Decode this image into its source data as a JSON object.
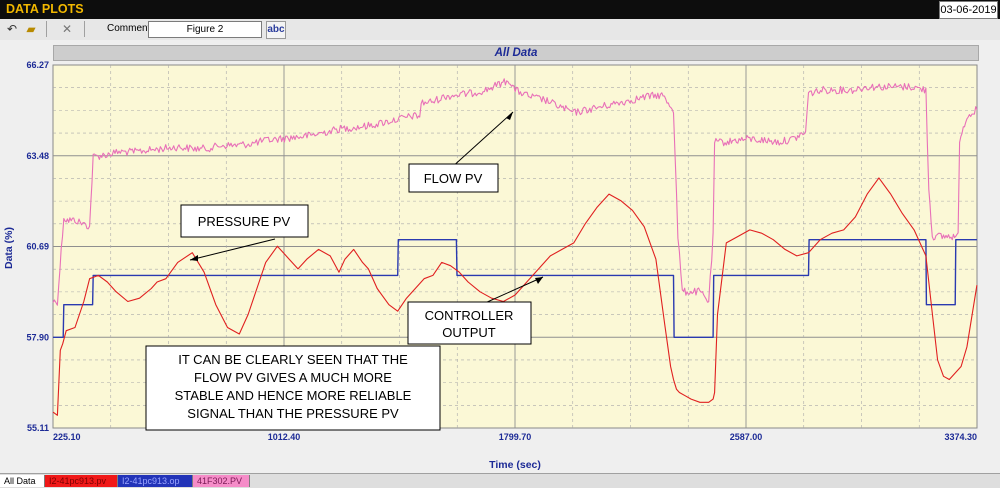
{
  "app": {
    "title": "DATA PLOTS",
    "date": "03-06-2019"
  },
  "toolbar": {
    "comment_label": "Comment",
    "comment_value": "Figure 2",
    "spell_label": "abc"
  },
  "tabs": [
    {
      "label": "All Data",
      "color": "#ffffff"
    },
    {
      "label": "I2-41pc913.pv",
      "color": "#f01818"
    },
    {
      "label": "I2-41pc913.op",
      "color": "#2233b8"
    },
    {
      "label": "41F302.PV",
      "color": "#f58cc8"
    }
  ],
  "annotations": {
    "flow_pv": "FLOW PV",
    "pressure_pv": "PRESSURE PV",
    "controller_output_line1": "CONTROLLER",
    "controller_output_line2": "OUTPUT",
    "note_line1": "IT CAN BE CLEARLY SEEN THAT THE",
    "note_line2": "FLOW PV GIVES A MUCH MORE",
    "note_line3": "STABLE AND HENCE MORE RELIABLE",
    "note_line4": "SIGNAL THAN THE PRESSURE PV"
  },
  "chart_data": {
    "type": "line",
    "title": "All Data",
    "xlabel": "Time (sec)",
    "ylabel": "Data (%)",
    "xlim": [
      225.1,
      3374.3
    ],
    "ylim": [
      55.11,
      66.27
    ],
    "xticks": [
      "225.10",
      "1012.40",
      "1799.70",
      "2587.00",
      "3374.30"
    ],
    "yticks": [
      "55.11",
      "57.90",
      "60.69",
      "63.48",
      "66.27"
    ],
    "grid": true,
    "colors": {
      "flow": "#e870b8",
      "pressure": "#e02020",
      "output": "#2a3ab0",
      "plot_bg": "#fbf8d6"
    },
    "series": [
      {
        "name": "41F302.PV",
        "x": [
          225,
          240,
          262,
          270,
          300,
          350,
          362,
          400,
          450,
          500,
          550,
          600,
          650,
          700,
          750,
          800,
          850,
          900,
          950,
          1000,
          1050,
          1100,
          1150,
          1200,
          1250,
          1300,
          1350,
          1400,
          1450,
          1475,
          1480,
          1520,
          1560,
          1600,
          1650,
          1700,
          1750,
          1780,
          1800,
          1850,
          1900,
          1950,
          2000,
          2050,
          2100,
          2150,
          2200,
          2250,
          2300,
          2340,
          2355,
          2370,
          2390,
          2430,
          2460,
          2475,
          2480,
          2520,
          2550,
          2600,
          2650,
          2700,
          2750,
          2790,
          2800,
          2850,
          2900,
          2950,
          3000,
          3050,
          3100,
          3150,
          3200,
          3210,
          3222,
          3260,
          3290,
          3310,
          3315,
          3340,
          3374
        ],
        "values": [
          59.0,
          59.0,
          61.6,
          61.5,
          61.5,
          61.3,
          63.45,
          63.5,
          63.6,
          63.6,
          63.65,
          63.7,
          63.75,
          63.7,
          63.7,
          63.8,
          63.8,
          63.85,
          63.95,
          64.0,
          64.05,
          64.1,
          64.2,
          64.3,
          64.35,
          64.4,
          64.5,
          64.6,
          64.7,
          64.7,
          65.1,
          65.15,
          65.3,
          65.35,
          65.4,
          65.5,
          65.7,
          65.8,
          65.5,
          65.3,
          65.2,
          65.0,
          64.8,
          64.9,
          65.0,
          65.1,
          65.2,
          65.3,
          65.35,
          64.9,
          61.0,
          59.3,
          59.3,
          59.3,
          59.0,
          61.0,
          63.9,
          63.9,
          63.95,
          64.0,
          63.95,
          63.9,
          64.0,
          64.2,
          65.4,
          65.5,
          65.5,
          65.5,
          65.6,
          65.6,
          65.6,
          65.6,
          65.5,
          62.5,
          61.0,
          61.0,
          61.0,
          61.0,
          64.0,
          64.7,
          64.9
        ]
      },
      {
        "name": "I2-41pc913.pv",
        "x": [
          225,
          240,
          250,
          258,
          270,
          300,
          330,
          350,
          380,
          410,
          440,
          480,
          520,
          560,
          580,
          610,
          650,
          700,
          740,
          780,
          820,
          860,
          890,
          920,
          950,
          990,
          1030,
          1060,
          1090,
          1130,
          1170,
          1200,
          1220,
          1250,
          1280,
          1300,
          1330,
          1370,
          1400,
          1430,
          1460,
          1490,
          1520,
          1550,
          1580,
          1610,
          1640,
          1680,
          1720,
          1760,
          1800,
          1840,
          1880,
          1920,
          1960,
          2000,
          2040,
          2080,
          2120,
          2160,
          2200,
          2240,
          2280,
          2310,
          2330,
          2340,
          2350,
          2360,
          2380,
          2400,
          2430,
          2460,
          2475,
          2480,
          2490,
          2520,
          2560,
          2600,
          2640,
          2680,
          2720,
          2760,
          2800,
          2840,
          2880,
          2920,
          2960,
          3000,
          3040,
          3080,
          3120,
          3160,
          3200,
          3220,
          3240,
          3260,
          3280,
          3300,
          3320,
          3340,
          3374
        ],
        "values": [
          55.6,
          55.5,
          57.5,
          57.7,
          58.1,
          58.2,
          59.0,
          59.7,
          59.8,
          59.6,
          59.3,
          59.0,
          59.1,
          59.4,
          59.6,
          59.7,
          60.2,
          60.5,
          59.9,
          58.9,
          58.2,
          58.0,
          58.6,
          59.4,
          60.2,
          60.7,
          60.3,
          60.0,
          60.3,
          60.6,
          60.4,
          59.9,
          60.3,
          60.6,
          60.2,
          60.0,
          59.4,
          58.9,
          58.7,
          59.1,
          59.4,
          59.7,
          59.8,
          60.2,
          60.1,
          59.9,
          59.6,
          59.3,
          59.1,
          59.0,
          59.2,
          59.6,
          60.0,
          60.4,
          60.6,
          60.8,
          61.4,
          61.9,
          62.3,
          62.1,
          61.8,
          61.3,
          60.3,
          58.3,
          57.0,
          56.6,
          56.3,
          56.2,
          56.1,
          56.0,
          55.9,
          55.9,
          56.0,
          56.2,
          58.6,
          60.8,
          61.0,
          61.2,
          61.1,
          60.9,
          60.6,
          60.4,
          60.5,
          60.9,
          61.1,
          61.2,
          61.6,
          62.3,
          62.8,
          62.3,
          61.7,
          61.2,
          60.4,
          58.8,
          57.2,
          56.7,
          56.6,
          56.8,
          57.0,
          57.6,
          59.5
        ]
      },
      {
        "name": "I2-41pc913.op",
        "x": [
          225,
          260,
          262,
          360,
          362,
          1400,
          1402,
          1600,
          1602,
          2340,
          2342,
          2475,
          2477,
          2800,
          2802,
          3200,
          3202,
          3300,
          3302,
          3374
        ],
        "values": [
          57.9,
          57.9,
          58.9,
          58.9,
          59.8,
          59.8,
          60.9,
          60.9,
          59.8,
          59.8,
          57.9,
          57.9,
          59.8,
          59.8,
          60.9,
          60.9,
          58.9,
          58.9,
          60.9,
          60.9
        ]
      }
    ]
  }
}
